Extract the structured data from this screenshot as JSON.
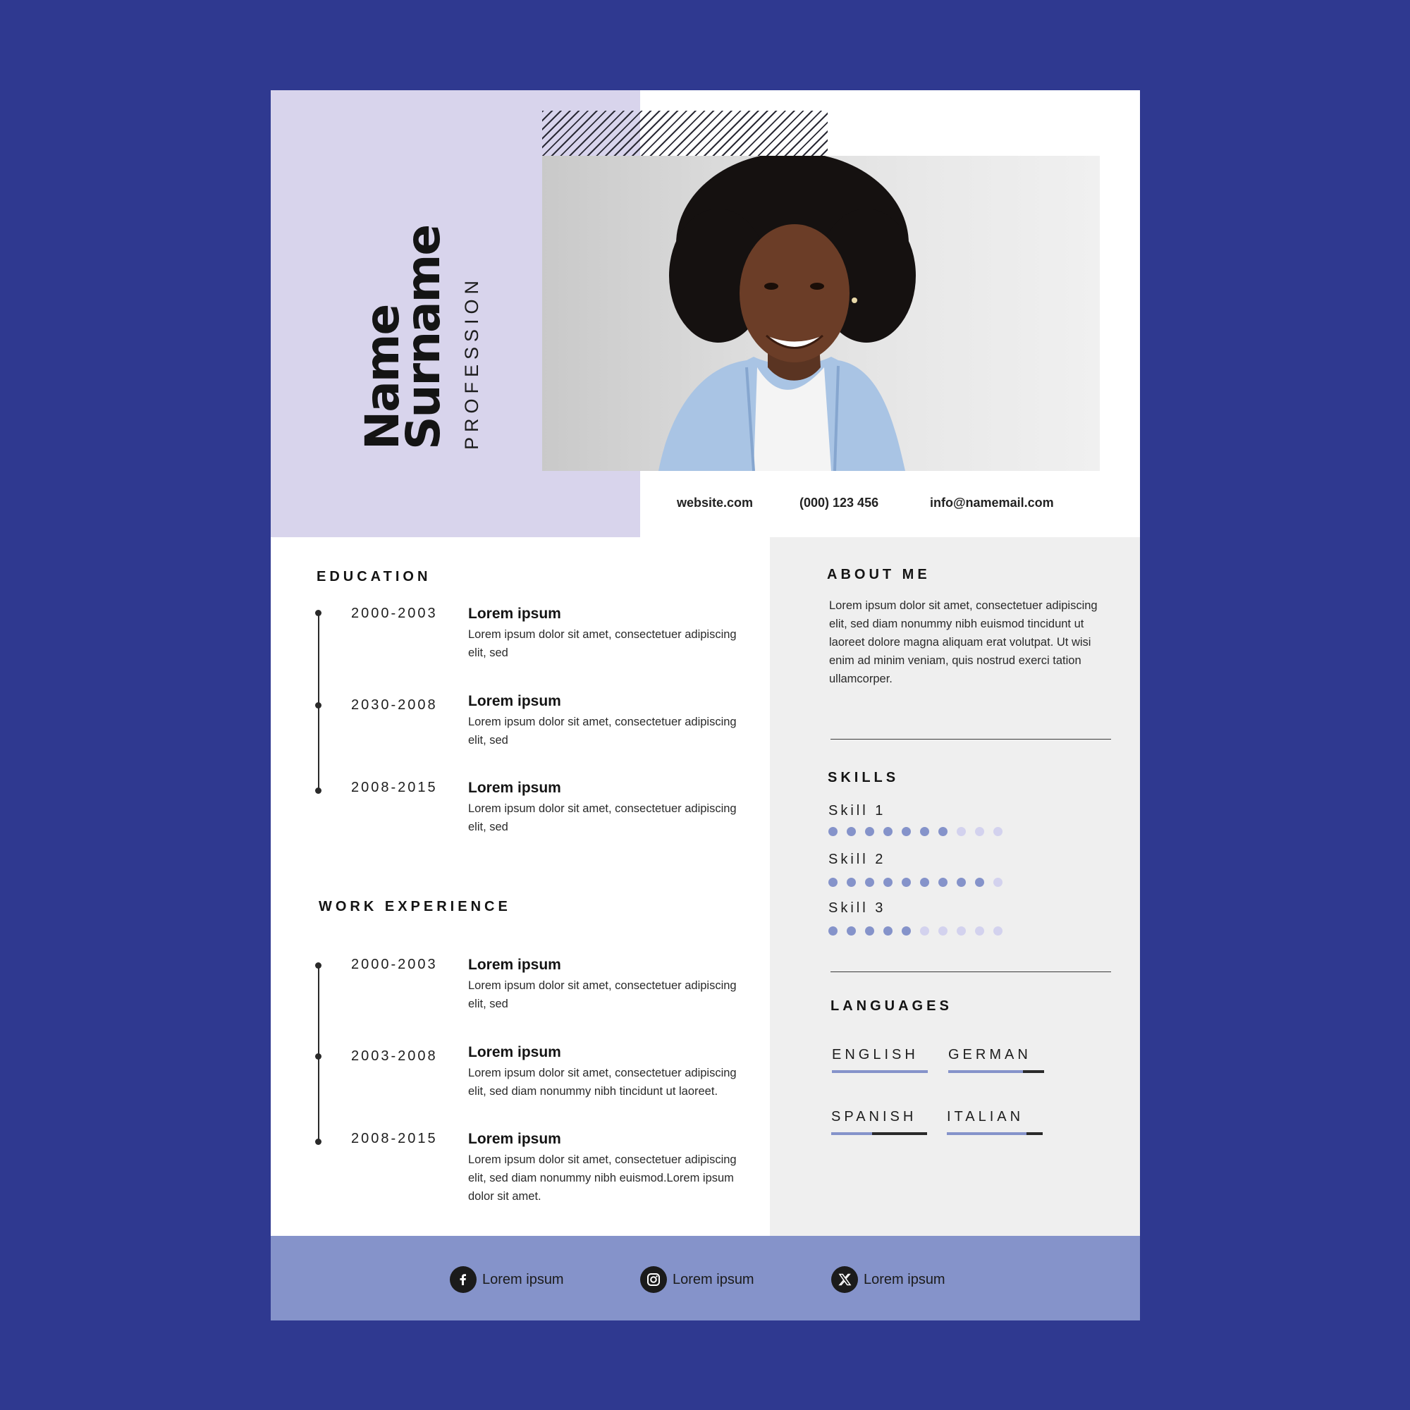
{
  "header": {
    "name": "Name",
    "surname": "Surname",
    "profession": "PROFESSION"
  },
  "contact": {
    "website": "website.com",
    "phone": "(000) 123 456",
    "email": "info@namemail.com"
  },
  "education": {
    "title": "EDUCATION",
    "entries": [
      {
        "years": "2000-2003",
        "title": "Lorem ipsum",
        "desc": "Lorem ipsum dolor sit amet, consectetuer adipiscing elit, sed"
      },
      {
        "years": "2030-2008",
        "title": "Lorem ipsum",
        "desc": "Lorem ipsum dolor sit amet, consectetuer adipiscing elit, sed"
      },
      {
        "years": "2008-2015",
        "title": "Lorem ipsum",
        "desc": "Lorem ipsum dolor sit amet, consectetuer adipiscing elit, sed"
      }
    ]
  },
  "work": {
    "title": "WORK EXPERIENCE",
    "entries": [
      {
        "years": "2000-2003",
        "title": "Lorem ipsum",
        "desc": "Lorem ipsum dolor sit amet, consectetuer adipiscing elit, sed"
      },
      {
        "years": "2003-2008",
        "title": "Lorem ipsum",
        "desc": "Lorem ipsum dolor sit amet, consectetuer adipiscing elit, sed diam nonummy nibh tincidunt ut laoreet."
      },
      {
        "years": "2008-2015",
        "title": "Lorem ipsum",
        "desc": "Lorem ipsum dolor sit amet, consectetuer adipiscing elit, sed diam nonummy nibh euismod.Lorem ipsum dolor sit amet."
      }
    ]
  },
  "about": {
    "title": "ABOUT ME",
    "text": "Lorem ipsum dolor sit amet, consectetuer adipiscing elit, sed diam nonummy nibh euismod tincidunt ut laoreet dolore magna aliquam erat volutpat. Ut wisi enim ad minim veniam, quis nostrud exerci tation ullamcorper."
  },
  "skills": {
    "title": "SKILLS",
    "max": 10,
    "items": [
      {
        "name": "Skill 1",
        "level": 7
      },
      {
        "name": "Skill 2",
        "level": 9
      },
      {
        "name": "Skill 3",
        "level": 5
      }
    ]
  },
  "languages": {
    "title": "LANGUAGES",
    "items": [
      {
        "name": "ENGLISH",
        "level": 1.0
      },
      {
        "name": "GERMAN",
        "level": 0.78
      },
      {
        "name": "SPANISH",
        "level": 0.43
      },
      {
        "name": "ITALIAN",
        "level": 0.83
      }
    ]
  },
  "social": [
    {
      "icon": "facebook-icon",
      "label": "Lorem ipsum"
    },
    {
      "icon": "instagram-icon",
      "label": "Lorem ipsum"
    },
    {
      "icon": "x-twitter-icon",
      "label": "Lorem ipsum"
    }
  ],
  "colors": {
    "background": "#2f3990",
    "lavender": "#d8d4ec",
    "accent": "#8593ca",
    "dot_off": "#d3d2ee",
    "panel_grey": "#efefef"
  }
}
